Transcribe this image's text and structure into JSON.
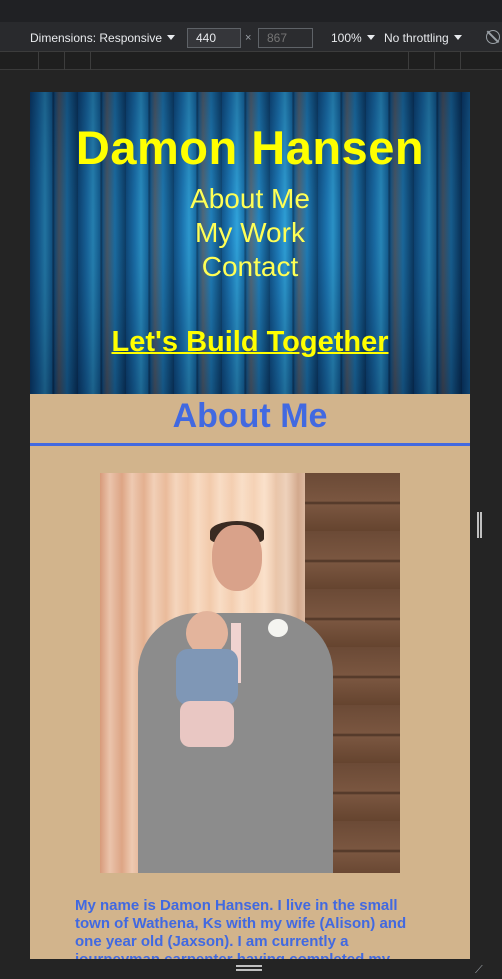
{
  "devtools": {
    "dimensions_label": "Dimensions: Responsive",
    "width_value": "440",
    "height_placeholder": "867",
    "times_sign": "×",
    "zoom_label": "100%",
    "throttling_label": "No throttling",
    "toggle_icon": "rotate-icon"
  },
  "site": {
    "name": "Damon Hansen",
    "nav": [
      "About Me",
      "My Work",
      "Contact"
    ],
    "cta": "Let's Build Together",
    "about_heading": "About Me",
    "bio": "My name is Damon Hansen. I live in the small town of Wathena, Ks with my wife (Alison) and one year old (Jaxson). I am currently a journeyman carpenter having completed my"
  },
  "colors": {
    "hero_text": "#ffff00",
    "accent_blue": "#4169e1",
    "page_bg": "#d2b48c"
  }
}
